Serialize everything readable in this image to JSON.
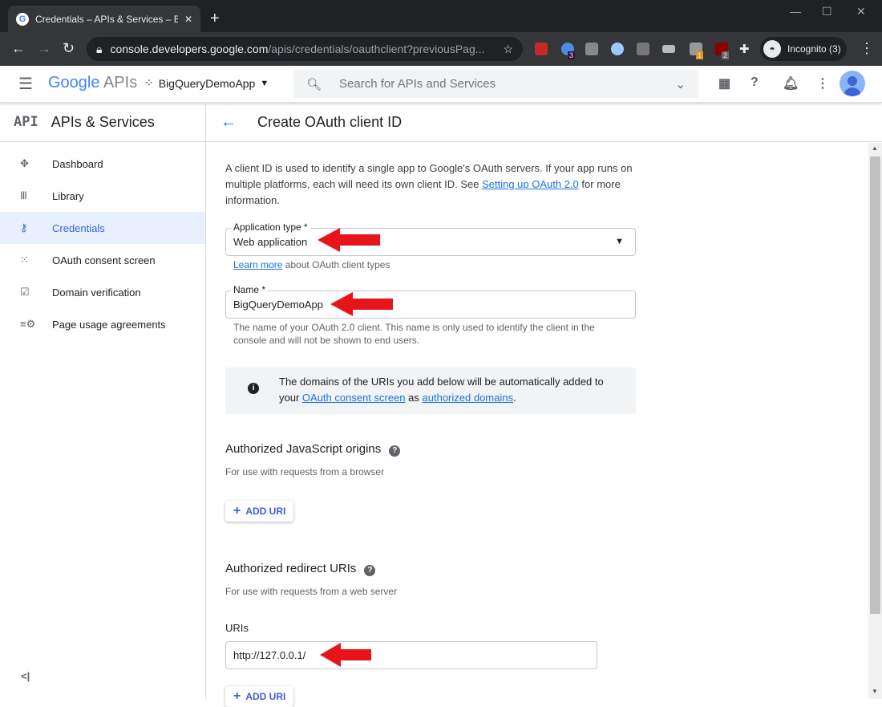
{
  "browser": {
    "tab_title": "Credentials – APIs & Services – BigQ",
    "url_host": "console.developers.google.com",
    "url_path": "/apis/credentials/oauthclient?previousPag...",
    "incognito": "Incognito (3)",
    "badges": [
      "3",
      "1",
      "2"
    ]
  },
  "header": {
    "logo_google": "Google",
    "logo_apis": "APIs",
    "project": "BigQueryDemoApp",
    "search_placeholder": "Search for APIs and Services"
  },
  "sidebar": {
    "api_glyph": "API",
    "title": "APIs & Services",
    "items": [
      {
        "label": "Dashboard"
      },
      {
        "label": "Library"
      },
      {
        "label": "Credentials"
      },
      {
        "label": "OAuth consent screen"
      },
      {
        "label": "Domain verification"
      },
      {
        "label": "Page usage agreements"
      }
    ]
  },
  "page": {
    "title": "Create OAuth client ID",
    "intro": "A client ID is used to identify a single app to Google's OAuth servers. If your app runs on multiple platforms, each will need its own client ID. See ",
    "intro_link": "Setting up OAuth 2.0",
    "intro_end": " for more information.",
    "app_type_label": "Application type *",
    "app_type_value": "Web application",
    "learn_more": "Learn more",
    "learn_more_rest": " about OAuth client types",
    "name_label": "Name *",
    "name_value": "BigQueryDemoApp",
    "name_hint": "The name of your OAuth 2.0 client. This name is only used to identify the client in the console and will not be shown to end users.",
    "info_text1": "The domains of the URIs you add below will be automatically added to your ",
    "info_link1": "OAuth consent screen",
    "info_mid": " as ",
    "info_link2": "authorized domains",
    "info_end": ".",
    "js_origins_title": "Authorized JavaScript origins",
    "js_origins_hint": "For use with requests from a browser",
    "add_uri": "ADD URI",
    "redirect_title": "Authorized redirect URIs",
    "redirect_hint": "For use with requests from a web server",
    "uris_label": "URIs",
    "uri_value": "http://127.0.0.1/"
  },
  "colors": {
    "accent": "#1a73e8",
    "annotation": "#e8141b"
  }
}
